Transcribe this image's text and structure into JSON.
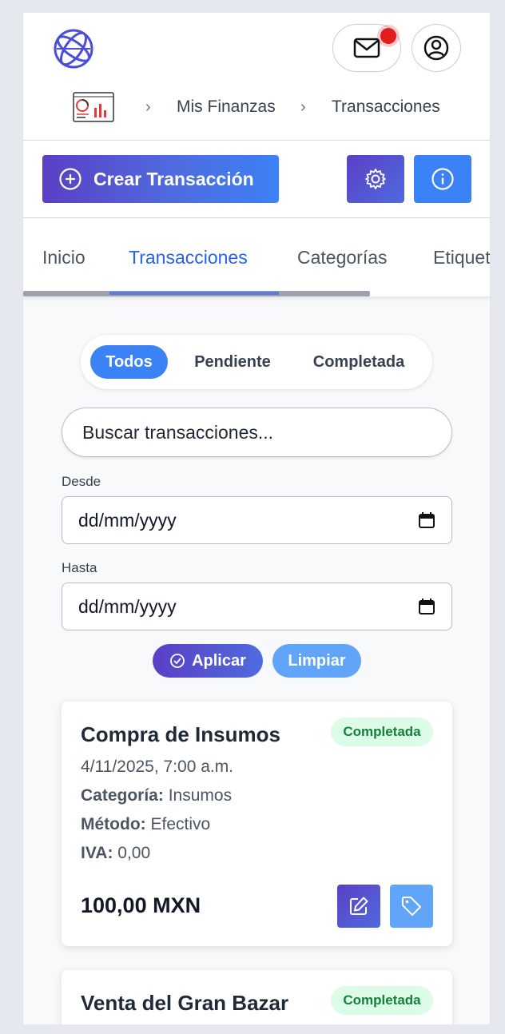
{
  "header": {
    "logo_icon": "globe-icon",
    "mail_icon": "envelope-icon",
    "profile_icon": "user-circle-icon",
    "notification_color": "#e11d1d"
  },
  "breadcrumb": {
    "home_icon": "finance-dashboard-icon",
    "items": [
      "Mis Finanzas",
      "Transacciones"
    ],
    "separator": "›"
  },
  "actions": {
    "create_label": "Crear Transacción",
    "create_icon": "plus-circle-icon",
    "settings_icon": "gear-icon",
    "info_icon": "info-icon",
    "accent_purple": "#5b3fc4",
    "accent_blue": "#3b82f6"
  },
  "tabs": [
    {
      "label": "Inicio",
      "active": false
    },
    {
      "label": "Transacciones",
      "active": true
    },
    {
      "label": "Categorías",
      "active": false
    },
    {
      "label": "Etiquetas",
      "active": false
    }
  ],
  "status_filter": {
    "options": [
      "Todos",
      "Pendiente",
      "Completada"
    ],
    "selected": "Todos"
  },
  "search": {
    "placeholder": "Buscar transacciones..."
  },
  "date_filters": {
    "from_label": "Desde",
    "from_value": "dd/mm/yyyy",
    "to_label": "Hasta",
    "to_value": "dd/mm/yyyy",
    "apply_label": "Aplicar",
    "clear_label": "Limpiar"
  },
  "transactions": [
    {
      "title": "Compra de Insumos",
      "status": "Completada",
      "date": "4/11/2025, 7:00 a.m.",
      "category_label": "Categoría:",
      "category": "Insumos",
      "method_label": "Método:",
      "method": "Efectivo",
      "tax_label": "IVA:",
      "tax": "0,00",
      "amount": "100,00 MXN"
    },
    {
      "title": "Venta del Gran Bazar",
      "status": "Completada"
    }
  ]
}
